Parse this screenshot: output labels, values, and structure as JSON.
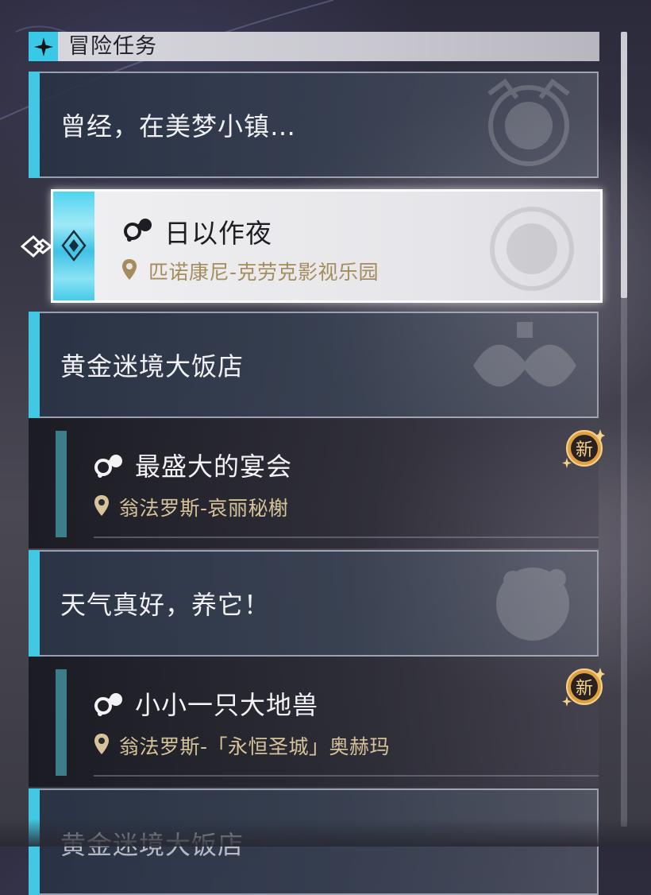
{
  "section": {
    "title": "冒险任务",
    "icon": "sparkle-icon"
  },
  "selected_quest": {
    "title": "日以作夜",
    "location": "匹诺康尼-克劳克影视乐园",
    "icon": "adventure-quest-icon"
  },
  "groups": [
    {
      "title": "曾经，在美梦小镇…"
    },
    {
      "title": "黄金迷境大饭店"
    },
    {
      "title": "天气真好，养它！"
    },
    {
      "title": "黄金迷境大饭店"
    }
  ],
  "quests": [
    {
      "title": "最盛大的宴会",
      "location": "翁法罗斯-哀丽秘榭",
      "badge": "新"
    },
    {
      "title": "小小一只大地兽",
      "location": "翁法罗斯-「永恒圣城」奥赫玛",
      "badge": "新"
    }
  ],
  "scrollbar": {
    "position_fraction": 0.0,
    "visible_fraction": 0.33
  },
  "colors": {
    "accent": "#43c8e3",
    "location_text": "#d6c39a",
    "badge": "#e0a040"
  }
}
